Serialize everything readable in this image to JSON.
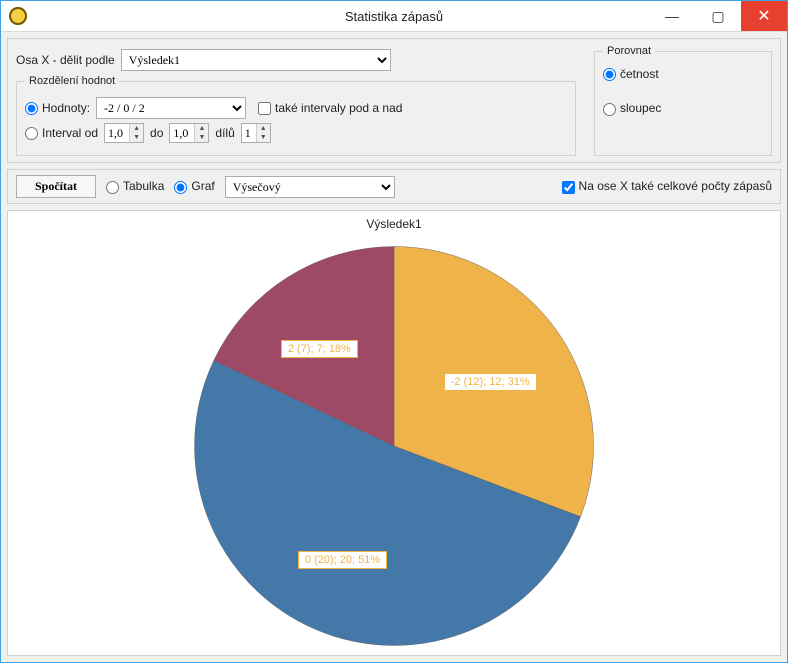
{
  "window": {
    "title": "Statistika zápasů"
  },
  "controls": {
    "xaxis_label": "Osa X - dělit podle",
    "xaxis_value": "Výsledek1",
    "rozdeleni_legend": "Rozdělení hodnot",
    "hodnoty_label": "Hodnoty:",
    "hodnoty_value": "-2 / 0 / 2",
    "take_intervaly_label": "také intervaly pod a nad",
    "interval_od_label": "Interval od",
    "interval_od_value": "1,0",
    "do_label": "do",
    "do_value": "1,0",
    "dilu_label": "dílů",
    "dilu_value": "1",
    "porovnat_legend": "Porovnat",
    "cetnost_label": "četnost",
    "sloupec_label": "sloupec",
    "compute_label": "Spočítat",
    "tabulka_label": "Tabulka",
    "graf_label": "Graf",
    "graf_type_value": "Výsečový",
    "totals_label": "Na ose X také celkové počty zápasů"
  },
  "chart_data": {
    "type": "pie",
    "title": "Výsledek1",
    "series": [
      {
        "name": "-2",
        "count": 12,
        "total": 12,
        "percent": 31,
        "color": "#f0b34a",
        "label": "-2 (12); 12; 31%"
      },
      {
        "name": "0",
        "count": 20,
        "total": 20,
        "percent": 51,
        "color": "#4378a8",
        "label": "0 (20); 20; 51%"
      },
      {
        "name": "2",
        "count": 7,
        "total": 7,
        "percent": 18,
        "color": "#9e4966",
        "label": "2 (7); 7; 18%"
      }
    ]
  }
}
